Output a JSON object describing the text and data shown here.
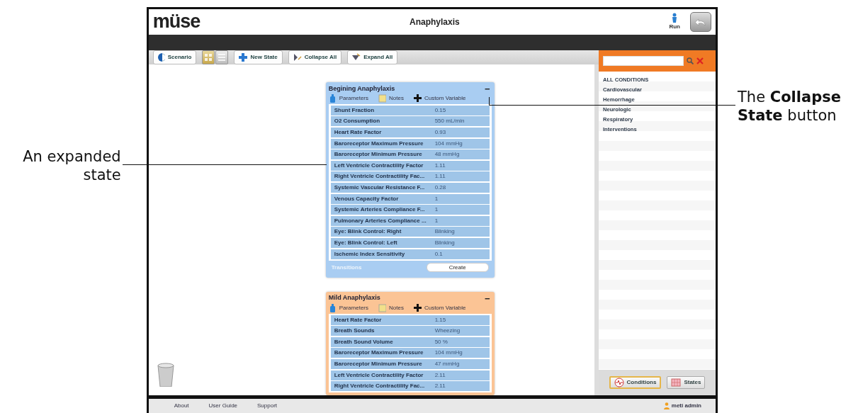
{
  "callouts": {
    "left": "An expanded state",
    "right": "The **Collapse State** button"
  },
  "header": {
    "logo": "müse",
    "title": "Anaphylaxis",
    "run_label": "Run"
  },
  "toolbar": {
    "scenario_label": "Scenario",
    "view_modes": [
      {
        "kind": "grid",
        "selected": true
      },
      {
        "kind": "list",
        "selected": false
      }
    ],
    "actions": [
      {
        "kind": "new",
        "label": "New State"
      },
      {
        "kind": "collapse",
        "label": "Collapse All"
      },
      {
        "kind": "expand",
        "label": "Expand All"
      }
    ]
  },
  "states": [
    {
      "title": "Begining Anaphylaxis",
      "color": "#a9cdf2",
      "expanded": true,
      "collapse_symbol": "−",
      "tabs": [
        {
          "kind": "parameters",
          "label": "Parameters"
        },
        {
          "kind": "notes",
          "label": "Notes"
        },
        {
          "kind": "custom",
          "label": "Custom Variable"
        }
      ],
      "parameters": [
        {
          "name": "Shunt Fraction",
          "value": "0.15"
        },
        {
          "name": "O2 Consumption",
          "value": "550 mL/min"
        },
        {
          "name": "Heart Rate Factor",
          "value": "0.93"
        },
        {
          "name": "Baroreceptor Maximum Pressure",
          "value": "104 mmHg"
        },
        {
          "name": "Baroreceptor Minimum Pressure",
          "value": "48 mmHg"
        },
        {
          "name": "Left Ventricle Contractility Factor",
          "value": "1.11"
        },
        {
          "name": "Right Ventricle Contractility Fac...",
          "value": "1.11"
        },
        {
          "name": "Systemic Vascular Resistance F...",
          "value": "0.28"
        },
        {
          "name": "Venous Capacity Factor",
          "value": "1"
        },
        {
          "name": "Systemic Arteries Compliance F...",
          "value": "1"
        },
        {
          "name": "Pulmonary Arteries Compliance ...",
          "value": "1"
        },
        {
          "name": "Eye: Blink Control: Right",
          "value": "Blinking"
        },
        {
          "name": "Eye: Blink Control: Left",
          "value": "Blinking"
        },
        {
          "name": "Ischemic Index Sensitivity",
          "value": "0.1"
        }
      ],
      "transitions_label": "Transitions",
      "create_label": "Create"
    },
    {
      "title": "Mild Anaphylaxis",
      "color": "#fbc495",
      "expanded": true,
      "collapse_symbol": "−",
      "tabs": [
        {
          "kind": "parameters",
          "label": "Parameters"
        },
        {
          "kind": "notes",
          "label": "Notes"
        },
        {
          "kind": "custom",
          "label": "Custom Variable"
        }
      ],
      "parameters": [
        {
          "name": "Heart Rate Factor",
          "value": "1.15"
        },
        {
          "name": "Breath Sounds",
          "value": "Wheezing"
        },
        {
          "name": "Breath Sound Volume",
          "value": "50 %"
        },
        {
          "name": "Baroreceptor Maximum Pressure",
          "value": "104 mmHg"
        },
        {
          "name": "Baroreceptor Minimum Pressure",
          "value": "47 mmHg"
        },
        {
          "name": "Left Ventricle Contractility Factor",
          "value": "2.11"
        },
        {
          "name": "Right Ventricle Contractility Fac...",
          "value": "2.11"
        }
      ]
    }
  ],
  "sidebar": {
    "categories": [
      "ALL CONDITIONS",
      "Cardiovascular",
      "Hemorrhage",
      "Neurologic",
      "Respiratory",
      "Interventions"
    ],
    "tabs": [
      {
        "kind": "conditions",
        "label": "Conditions",
        "selected": true
      },
      {
        "kind": "states",
        "label": "States",
        "selected": false
      }
    ]
  },
  "footer": {
    "links": [
      "About",
      "User Guide",
      "Support"
    ],
    "user": "meti admin"
  }
}
